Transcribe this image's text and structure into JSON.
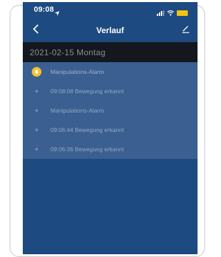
{
  "status_bar": {
    "time": "09:08"
  },
  "nav": {
    "title": "Verlauf"
  },
  "date_header": {
    "text": "2021-02-15  Montag"
  },
  "events": [
    {
      "text": "Manipulations-Alarm",
      "icon": "bell-icon"
    },
    {
      "text": "09:08:08 Bewegung erkannt",
      "icon": "dot"
    },
    {
      "text": "Manipulations-Alarm",
      "icon": "dot"
    },
    {
      "text": "09:06:44 Bewegung erkannt",
      "icon": "dot"
    },
    {
      "text": "09:06:36 Bewegung erkannt",
      "icon": "dot"
    }
  ],
  "colors": {
    "screen_bg": "#1d4a80",
    "list_bg": "#3a5f90",
    "date_header_bg": "#14181e",
    "alarm_accent": "#f2c12e",
    "battery": "#f1c40f"
  }
}
